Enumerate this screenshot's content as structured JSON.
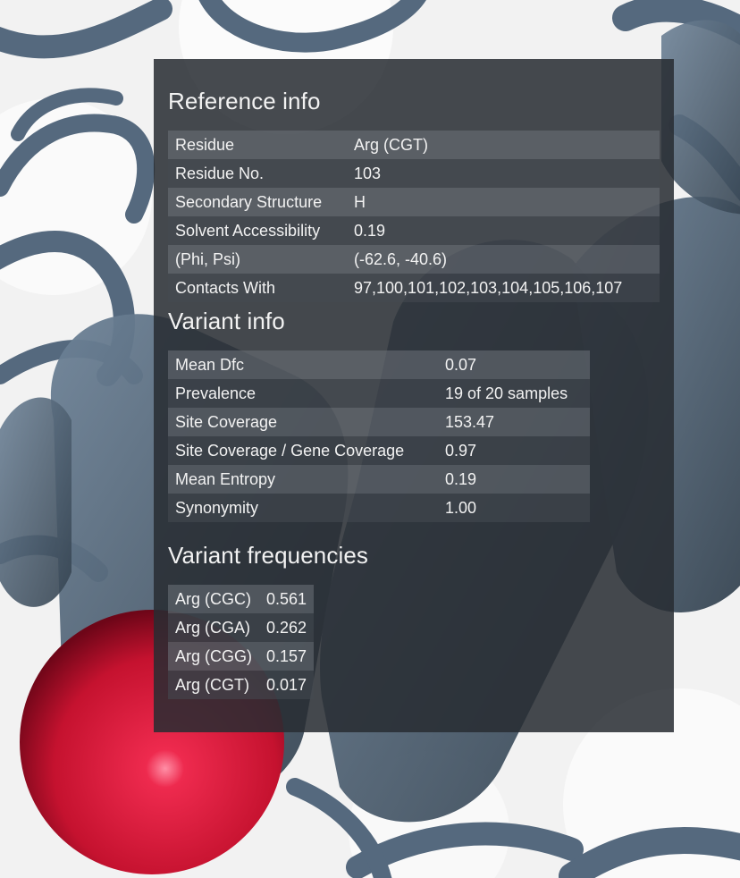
{
  "reference": {
    "title": "Reference info",
    "rows": [
      {
        "label": "Residue",
        "value": "Arg (CGT)"
      },
      {
        "label": "Residue No.",
        "value": "103"
      },
      {
        "label": "Secondary Structure",
        "value": "H"
      },
      {
        "label": "Solvent Accessibility",
        "value": "0.19"
      },
      {
        "label": "(Phi, Psi)",
        "value": "(-62.6, -40.6)"
      },
      {
        "label": "Contacts With",
        "value": "97,100,101,102,103,104,105,106,107"
      }
    ]
  },
  "variant": {
    "title": "Variant info",
    "rows": [
      {
        "label": "Mean Dfc",
        "value": "0.07"
      },
      {
        "label": "Prevalence",
        "value": "19 of 20 samples"
      },
      {
        "label": "Site Coverage",
        "value": "153.47"
      },
      {
        "label": "Site Coverage / Gene Coverage",
        "value": "0.97"
      },
      {
        "label": "Mean Entropy",
        "value": "0.19"
      },
      {
        "label": "Synonymity",
        "value": "1.00"
      }
    ]
  },
  "frequencies": {
    "title": "Variant frequencies",
    "rows": [
      {
        "label": "Arg (CGC)",
        "value": "0.561"
      },
      {
        "label": "Arg (CGA)",
        "value": "0.262"
      },
      {
        "label": "Arg (CGG)",
        "value": "0.157"
      },
      {
        "label": "Arg (CGT)",
        "value": "0.017"
      }
    ]
  },
  "colors": {
    "ribbon": "#55697e",
    "highlight_sphere": "#d8153a",
    "background": "#f3f3f3"
  }
}
